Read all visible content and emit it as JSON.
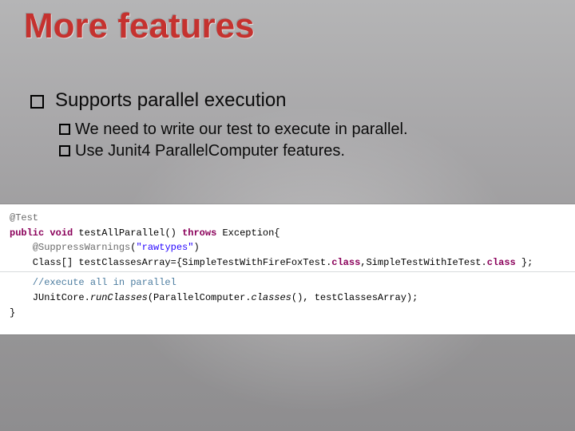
{
  "title": "More features",
  "bullets": {
    "level1": "Supports parallel execution",
    "level2a": "We need to write our test to execute in parallel.",
    "level2b": "Use Junit4 ParallelComputer features."
  },
  "code": {
    "at": "@",
    "anno_test": "Test",
    "kw_public": "public",
    "kw_void": "void",
    "method": " testAllParallel() ",
    "kw_throws": "throws",
    "exception": " Exception{",
    "indent1": "    ",
    "anno_suppress": "SuppressWarnings",
    "lparen": "(",
    "str_rawtypes": "\"rawtypes\"",
    "rparen": ")",
    "class_decl": "    Class[] testClassesArray={SimpleTestWithFireFoxTest.",
    "kw_class1": "class",
    "comma": ",SimpleTestWithIeTest.",
    "kw_class2": "class",
    "end_array": " };",
    "comment": "    //execute all in parallel",
    "run_line_a": "    JUnitCore.",
    "run_static": "runClasses",
    "run_line_b": "(ParallelComputer.",
    "run_static2": "classes",
    "run_line_c": "(), testClassesArray);",
    "close": "}"
  }
}
